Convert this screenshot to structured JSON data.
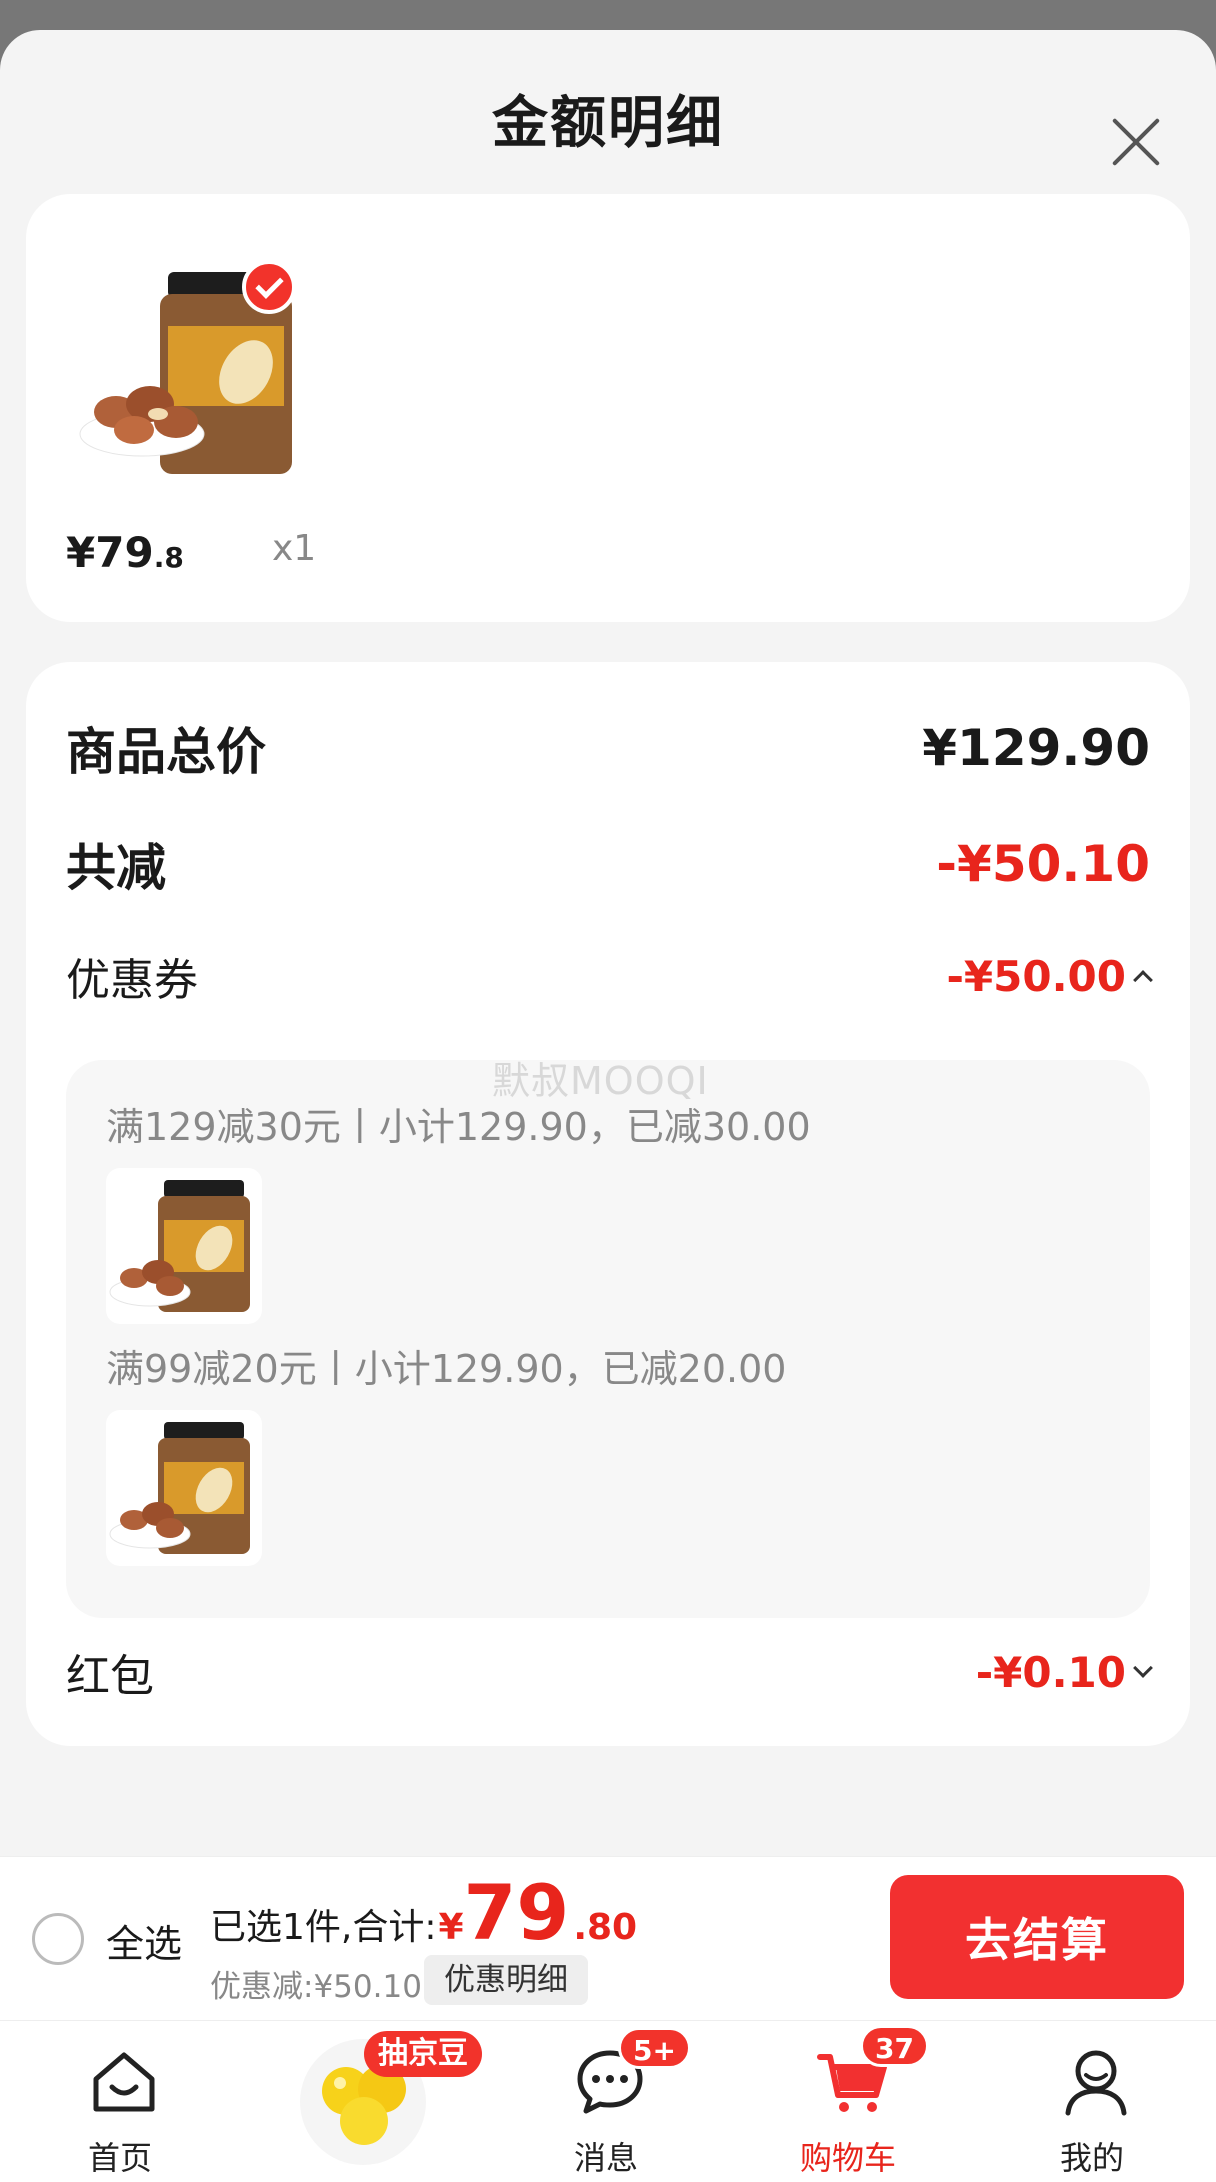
{
  "sheet": {
    "title": "金额明细"
  },
  "product": {
    "price_symbol": "¥",
    "price_int": "79",
    "price_dec": ".8",
    "quantity": "x1"
  },
  "summary": {
    "total_label": "商品总价",
    "total_value": "¥129.90",
    "reduce_label": "共减",
    "reduce_value": "-¥50.10",
    "coupon_label": "优惠券",
    "coupon_value": "-¥50.00",
    "coupon_items": [
      {
        "text": "满129减30元丨小计129.90，已减30.00"
      },
      {
        "text": "满99减20元丨小计129.90，已减20.00"
      }
    ],
    "redpacket_label": "红包",
    "redpacket_value": "-¥0.10"
  },
  "watermark": "默叔MOOQI",
  "checkout": {
    "select_all": "全选",
    "sum_label": "已选1件,合计:",
    "sum_currency": "¥",
    "sum_int": "79",
    "sum_dec": ".80",
    "discount_text": "优惠减:¥50.10",
    "discount_detail": "优惠明细",
    "pay_button": "去结算"
  },
  "tabbar": {
    "items": [
      {
        "label": "首页",
        "icon": "home-icon"
      },
      {
        "label": "抽京豆",
        "icon": "jd-bean-icon"
      },
      {
        "label": "消息",
        "icon": "message-icon",
        "badge": "5+"
      },
      {
        "label": "购物车",
        "icon": "cart-icon",
        "badge": "37"
      },
      {
        "label": "我的",
        "icon": "profile-icon"
      }
    ]
  },
  "colors": {
    "accent": "#e8251c",
    "button": "#f23030",
    "background": "#f4f4f4"
  }
}
